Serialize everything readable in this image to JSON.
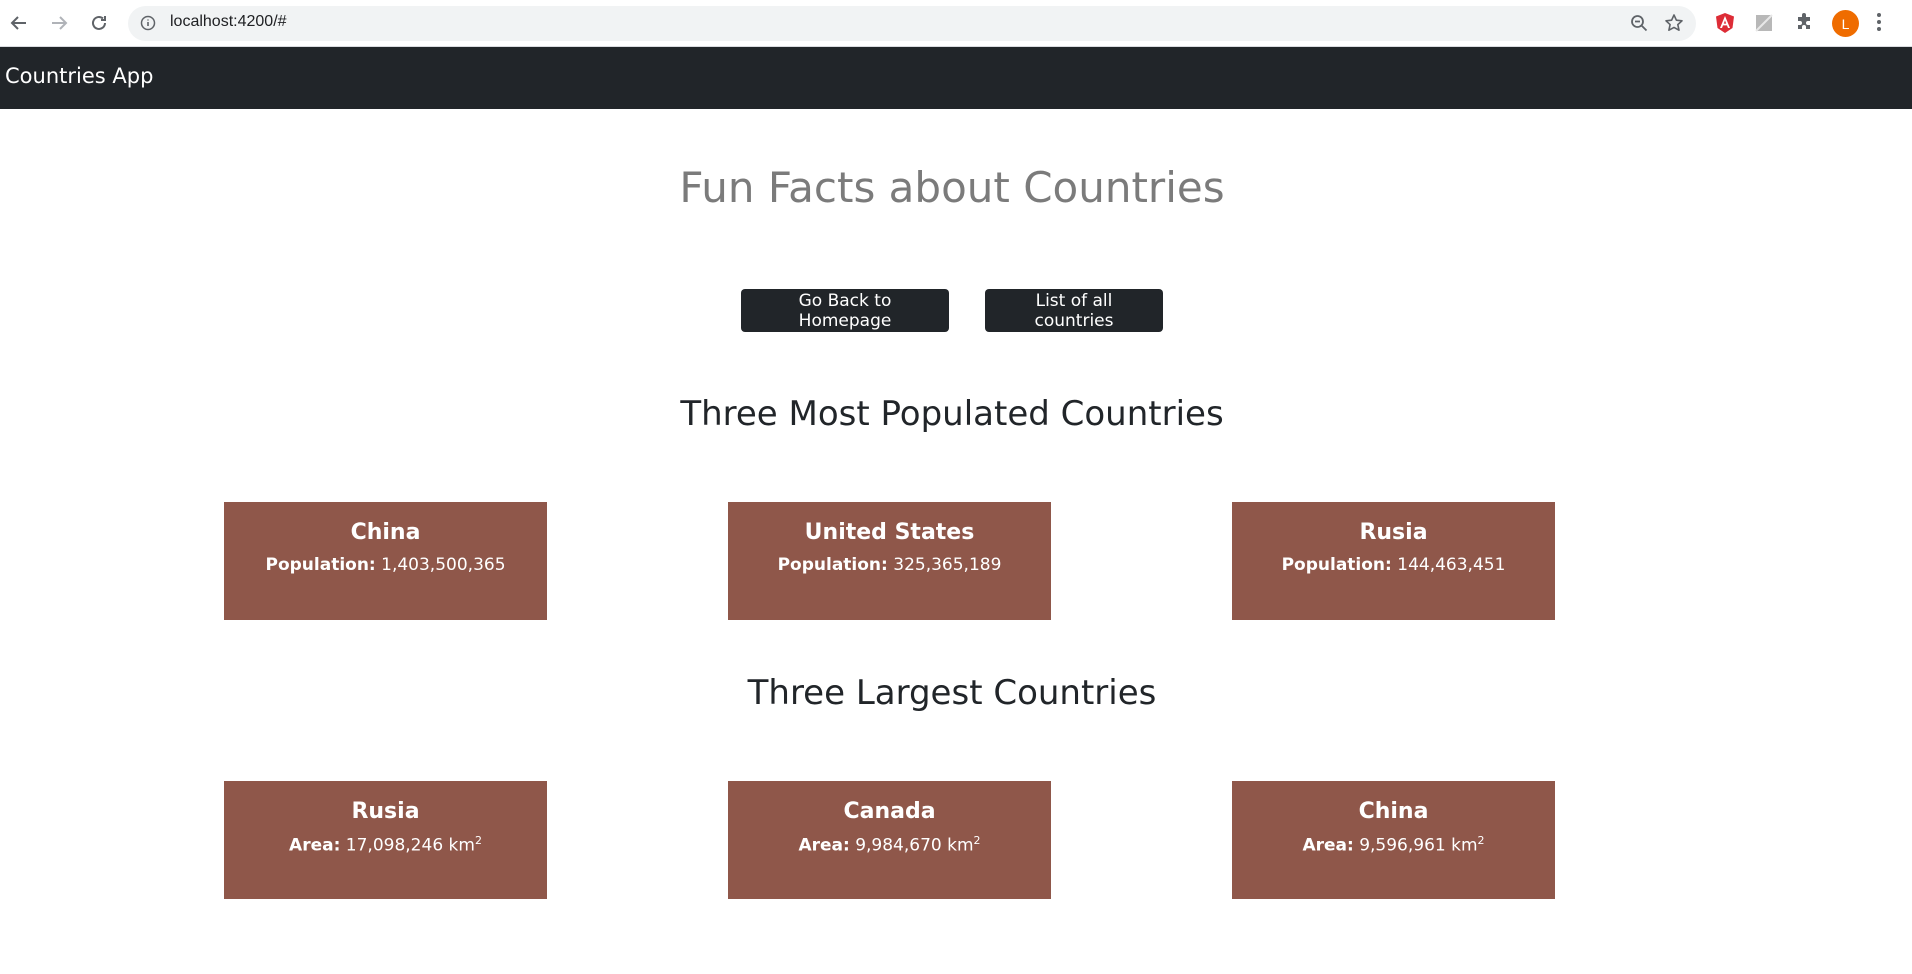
{
  "browser": {
    "url": "localhost:4200/#",
    "avatar_letter": "L"
  },
  "navbar": {
    "brand": "Countries App"
  },
  "main": {
    "title": "Fun Facts about Countries",
    "buttons": {
      "home": "Go Back to Homepage",
      "list": "List of all countries"
    },
    "populated": {
      "title": "Three Most Populated Countries",
      "label": "Population:",
      "items": [
        {
          "name": "China",
          "value": "1,403,500,365"
        },
        {
          "name": "United States",
          "value": "325,365,189"
        },
        {
          "name": "Rusia",
          "value": "144,463,451"
        }
      ]
    },
    "largest": {
      "title": "Three Largest Countries",
      "label": "Area:",
      "unit": "km",
      "unit_sup": "2",
      "items": [
        {
          "name": "Rusia",
          "value": "17,098,246"
        },
        {
          "name": "Canada",
          "value": "9,984,670"
        },
        {
          "name": "China",
          "value": "9,596,961"
        }
      ]
    }
  },
  "colors": {
    "navbar": "#212529",
    "card": "#8f574a",
    "title": "#7b7b7b"
  }
}
